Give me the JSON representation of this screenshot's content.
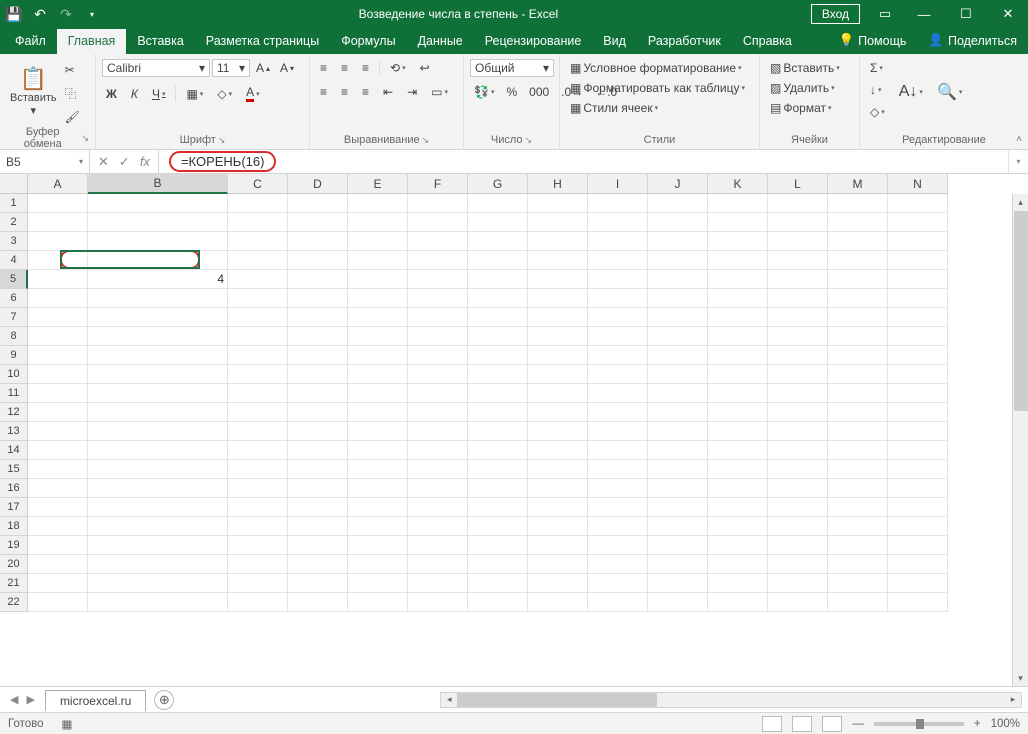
{
  "titlebar": {
    "title": "Возведение числа в степень  -  Excel",
    "login": "Вход"
  },
  "tabs": {
    "file": "Файл",
    "home": "Главная",
    "insert": "Вставка",
    "layout": "Разметка страницы",
    "formulas": "Формулы",
    "data": "Данные",
    "review": "Рецензирование",
    "view": "Вид",
    "developer": "Разработчик",
    "help": "Справка",
    "assist": "Помощь",
    "share": "Поделиться"
  },
  "ribbon": {
    "clipboard": {
      "paste": "Вставить",
      "label": "Буфер обмена"
    },
    "font": {
      "name": "Calibri",
      "size": "11",
      "label": "Шрифт"
    },
    "align": {
      "label": "Выравнивание"
    },
    "number": {
      "format": "Общий",
      "label": "Число"
    },
    "styles": {
      "cond": "Условное форматирование",
      "table": "Форматировать как таблицу",
      "cells": "Стили ячеек",
      "label": "Стили"
    },
    "cells": {
      "insert": "Вставить",
      "delete": "Удалить",
      "format": "Формат",
      "label": "Ячейки"
    },
    "editing": {
      "label": "Редактирование"
    }
  },
  "formulabar": {
    "cellref": "B5",
    "formula": "=КОРЕНЬ(16)"
  },
  "grid": {
    "cols": [
      "A",
      "B",
      "C",
      "D",
      "E",
      "F",
      "G",
      "H",
      "I",
      "J",
      "K",
      "L",
      "M",
      "N"
    ],
    "rows": [
      "1",
      "2",
      "3",
      "4",
      "5",
      "6",
      "7",
      "8",
      "9",
      "10",
      "11",
      "12",
      "13",
      "14",
      "15",
      "16",
      "17",
      "18",
      "19",
      "20",
      "21",
      "22"
    ],
    "selected_col": "B",
    "selected_row": "5",
    "cell_value": "4"
  },
  "sheet": {
    "name": "microexcel.ru"
  },
  "status": {
    "ready": "Готово",
    "zoom": "100%",
    "plus": "+"
  }
}
